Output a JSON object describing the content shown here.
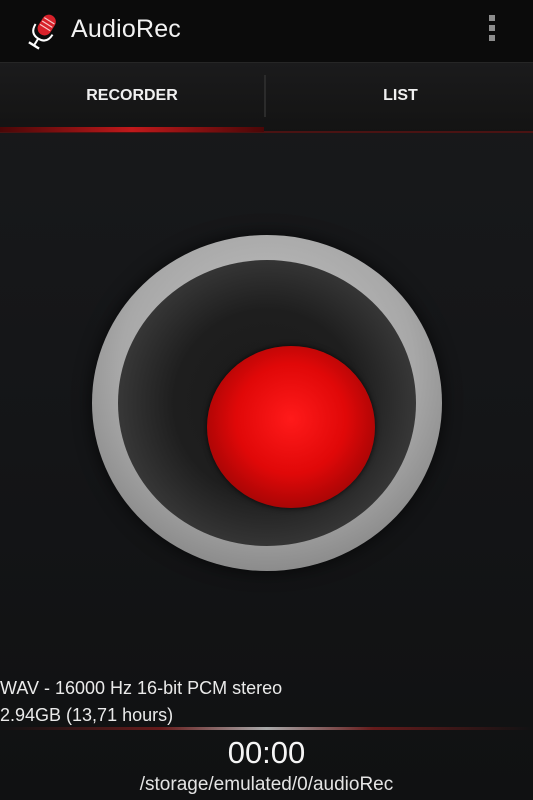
{
  "app": {
    "title": "AudioRec",
    "icon": "microphone-icon",
    "overflow_icon": "overflow-menu-icon"
  },
  "tabs": [
    {
      "label": "RECORDER",
      "selected": true
    },
    {
      "label": "LIST",
      "selected": false
    }
  ],
  "recorder": {
    "record_button_icon": "record-icon",
    "format": "WAV - 16000 Hz 16-bit PCM stereo",
    "free_space": "2.94GB (13,71 hours)",
    "timer": "00:00",
    "path": "/storage/emulated/0/audioRec"
  },
  "colors": {
    "accent": "#c0191b",
    "record_red": "#e00808",
    "background": "#141517",
    "action_bar": "#0b0b0b"
  }
}
